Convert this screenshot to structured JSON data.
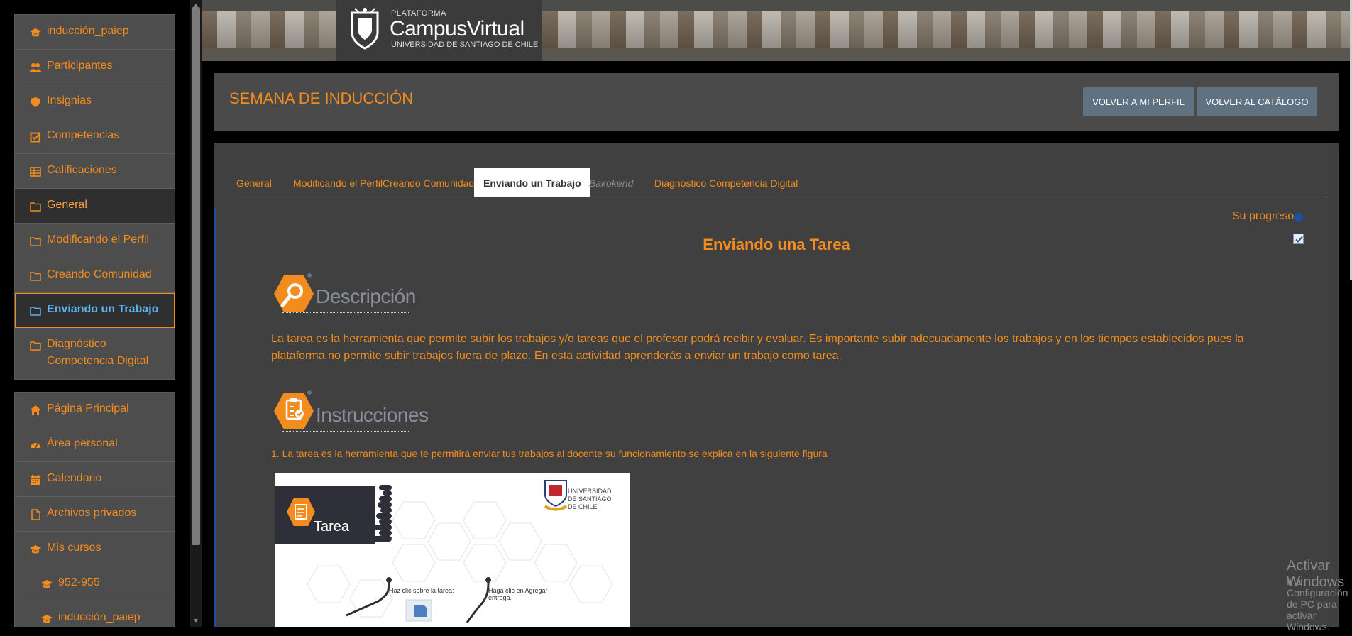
{
  "sidebar": {
    "course_block": [
      {
        "label": "inducción_paiep",
        "icon": "graduation-cap-icon"
      },
      {
        "label": "Participantes",
        "icon": "users-icon"
      },
      {
        "label": "Insignias",
        "icon": "shield-icon"
      },
      {
        "label": "Competencias",
        "icon": "checkbox-icon"
      },
      {
        "label": "Calificaciones",
        "icon": "table-icon"
      },
      {
        "label": "General",
        "icon": "folder-icon"
      },
      {
        "label": "Modificando el Perfil",
        "icon": "folder-icon"
      },
      {
        "label": "Creando Comunidad",
        "icon": "folder-icon"
      },
      {
        "label": "Enviando un Trabajo",
        "icon": "folder-icon"
      },
      {
        "label": "Diagnóstico Competencia Digital",
        "icon": "folder-icon"
      }
    ],
    "site_block": [
      {
        "label": "Página Principal",
        "icon": "home-icon"
      },
      {
        "label": "Área personal",
        "icon": "dashboard-icon"
      },
      {
        "label": "Calendario",
        "icon": "calendar-icon"
      },
      {
        "label": "Archivos privados",
        "icon": "file-icon"
      },
      {
        "label": "Mis cursos",
        "icon": "graduation-cap-icon"
      },
      {
        "label": "952-955",
        "icon": "graduation-cap-icon"
      },
      {
        "label": "inducción_paiep",
        "icon": "graduation-cap-icon"
      }
    ]
  },
  "banner": {
    "plataforma": "PLATAFORMA",
    "campus": "CampusVirtual",
    "university": "UNIVERSIDAD DE SANTIAGO DE CHILE"
  },
  "header": {
    "course_title": "SEMANA DE INDUCCIÓN",
    "btn_profile": "VOLVER A MI PERFIL",
    "btn_catalog": "VOLVER AL CATÁLOGO"
  },
  "tabs": [
    "General",
    "Modificando el Perfil",
    "Creando Comunidad",
    "Enviando un Trabajo",
    "Bakokend",
    "Diagnóstico Competencia Digital"
  ],
  "content": {
    "progress_label": "Su progreso",
    "section_title": "Enviando una Tarea",
    "desc_heading": "Descripción",
    "desc_text": "La tarea es la herramienta que permite subir los trabajos y/o tareas que el profesor podrá recibir y evaluar. Es importante subir adecuadamente los trabajos y en los tiempos establecidos pues la plataforma no permite subir trabajos fuera de plazo. En esta actividad aprenderás a enviar un trabajo como tarea.",
    "instr_heading": "Instrucciones",
    "instr_item": "1.  La tarea es la herramienta que te permitirá enviar tus trabajos al docente su funcionamiento se explica en la siguiente figura"
  },
  "figure": {
    "label": "Tarea",
    "univ_line1": "UNIVERSIDAD",
    "univ_line2": "DE SANTIAGO",
    "univ_line3": "DE CHILE",
    "note1": "Haz clic sobre la tarea:",
    "note2_line1": "Haga  clic  en  Agregar",
    "note2_line2": "entrega."
  },
  "watermark": {
    "line1": "Activar Windows",
    "line2": "Ir a Configuración de PC para activar Windows."
  },
  "colors": {
    "accent": "#f28c1e",
    "active_link": "#5ab4f0",
    "button": "#5e7282"
  }
}
